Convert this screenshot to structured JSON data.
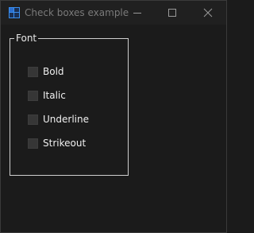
{
  "window": {
    "title": "Check boxes example",
    "icon": "app-grid-icon"
  },
  "caption_buttons": {
    "minimize_icon": "minimize-icon",
    "maximize_icon": "maximize-icon",
    "close_icon": "close-icon"
  },
  "group": {
    "title": "Font",
    "items": [
      {
        "label": "Bold",
        "checked": false
      },
      {
        "label": "Italic",
        "checked": false
      },
      {
        "label": "Underline",
        "checked": false
      },
      {
        "label": "Strikeout",
        "checked": false
      }
    ]
  },
  "colors": {
    "background": "#1b1b1b",
    "titlebar": "#202020",
    "group_border": "#cfcfcf",
    "checkbox_fill": "#363636",
    "accent": "#3a8ff0"
  }
}
